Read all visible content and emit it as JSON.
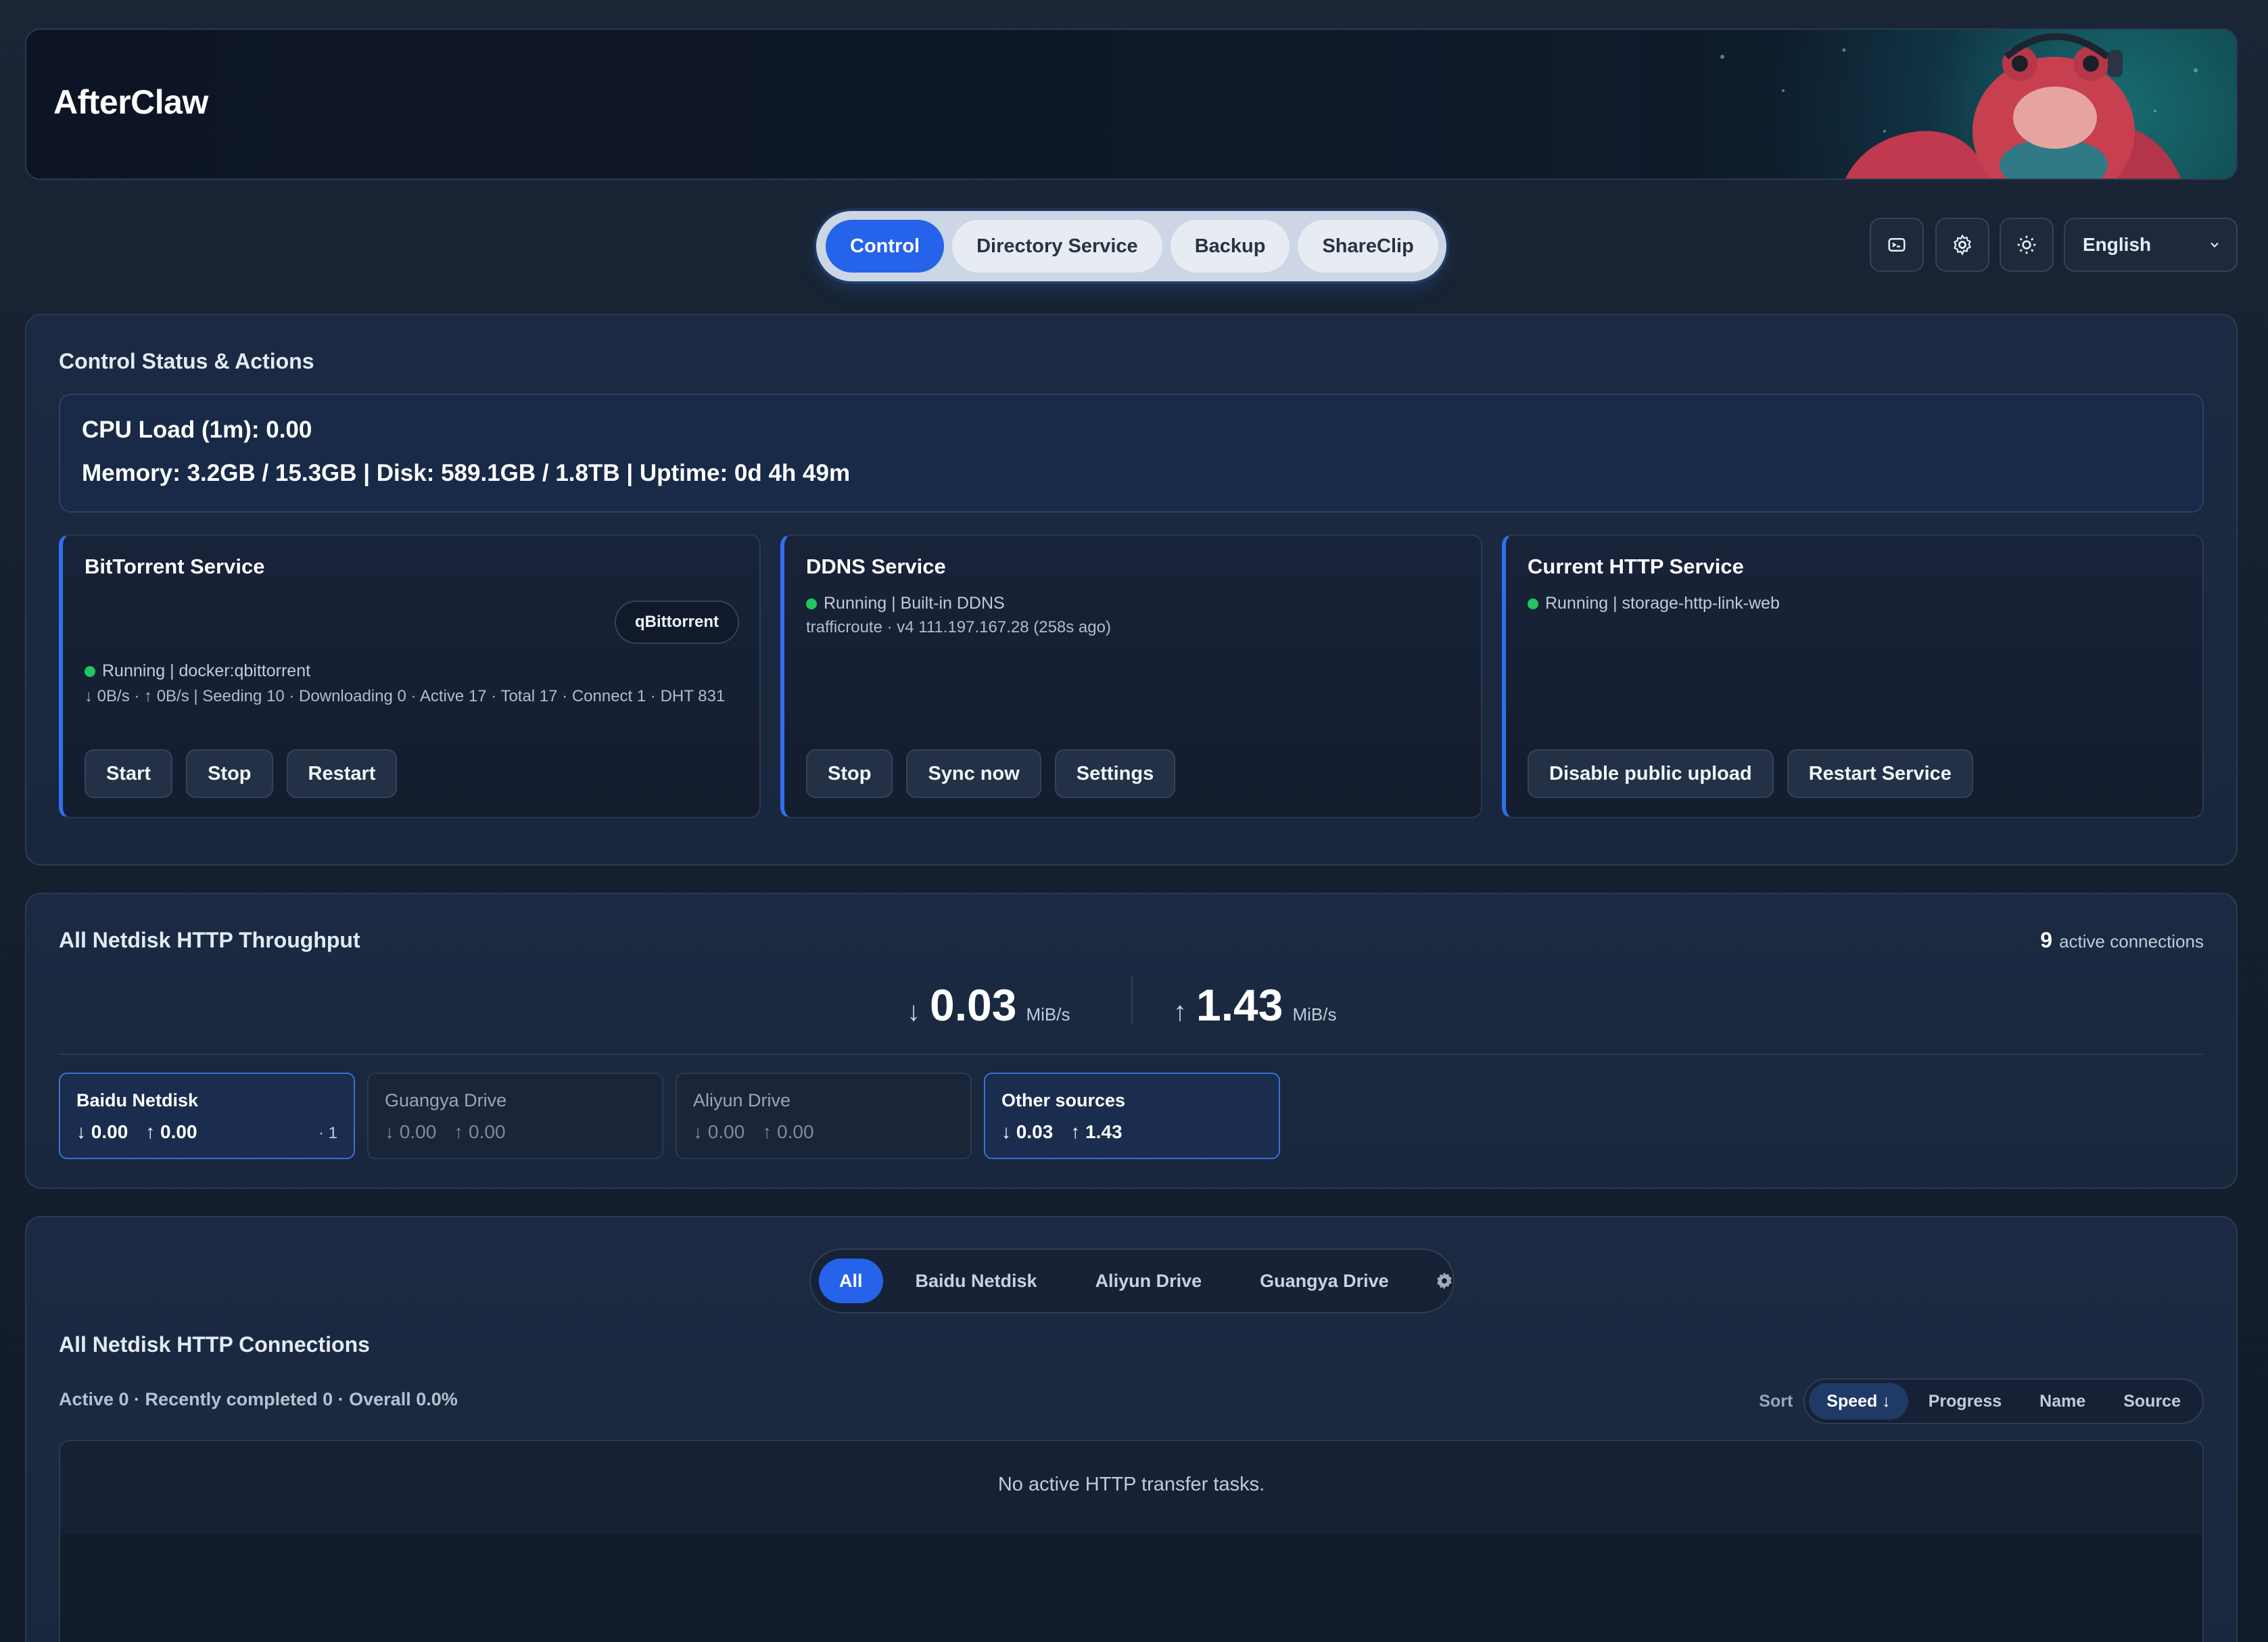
{
  "app": {
    "title": "AfterClaw"
  },
  "nav": {
    "tabs": [
      {
        "label": "Control",
        "active": true
      },
      {
        "label": "Directory Service"
      },
      {
        "label": "Backup"
      },
      {
        "label": "ShareClip"
      }
    ],
    "icons": [
      "terminal-icon",
      "gear-icon",
      "sun-icon"
    ],
    "language": "English"
  },
  "control": {
    "title": "Control Status & Actions",
    "cpu": "CPU Load (1m): 0.00",
    "memory": "Memory: 3.2GB / 15.3GB | Disk: 589.1GB / 1.8TB | Uptime: 0d 4h 49m",
    "bittorrent": {
      "title": "BitTorrent Service",
      "badge": "qBittorrent",
      "status": "Running | docker:qbittorrent",
      "detail": "↓ 0B/s · ↑ 0B/s | Seeding 10 · Downloading 0 · Active 17 · Total 17 · Connect 1 · DHT 831",
      "buttons": [
        "Start",
        "Stop",
        "Restart"
      ]
    },
    "ddns": {
      "title": "DDNS Service",
      "status": "Running | Built-in DDNS",
      "detail": "trafficroute · v4 111.197.167.28 (258s ago)",
      "buttons": [
        "Stop",
        "Sync now",
        "Settings"
      ]
    },
    "http": {
      "title": "Current HTTP Service",
      "status": "Running | storage-http-link-web",
      "buttons": [
        "Disable public upload",
        "Restart Service"
      ]
    }
  },
  "throughput": {
    "title": "All Netdisk HTTP Throughput",
    "active_count": "9",
    "active_label": "active connections",
    "down": "0.03",
    "up": "1.43",
    "unit": "MiB/s",
    "cards": [
      {
        "name": "Baidu Netdisk",
        "down": "↓ 0.00",
        "up": "↑ 0.00",
        "count": "· 1"
      },
      {
        "name": "Guangya Drive",
        "down": "↓ 0.00",
        "up": "↑ 0.00"
      },
      {
        "name": "Aliyun Drive",
        "down": "↓ 0.00",
        "up": "↑ 0.00"
      },
      {
        "name": "Other sources",
        "down": "↓ 0.03",
        "up": "↑ 1.43"
      }
    ]
  },
  "connections": {
    "filters": [
      "All",
      "Baidu Netdisk",
      "Aliyun Drive",
      "Guangya Drive"
    ],
    "title": "All Netdisk HTTP Connections",
    "summary": "Active 0 · Recently completed 0 · Overall 0.0%",
    "sort_label": "Sort",
    "sort_options": [
      "Speed ↓",
      "Progress",
      "Name",
      "Source"
    ],
    "empty": "No active HTTP transfer tasks."
  },
  "colors": {
    "accent": "#2563eb",
    "running": "#22c55e"
  }
}
